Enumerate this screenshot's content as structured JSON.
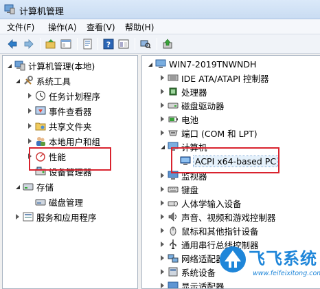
{
  "window": {
    "title": "计算机管理"
  },
  "menu": [
    "文件(F)",
    "操作(A)",
    "查看(V)",
    "帮助(H)"
  ],
  "toolbar": [
    "back-icon",
    "forward-icon",
    "up-folder-icon",
    "show-tree-icon",
    "properties-icon",
    "help-icon",
    "console-view-icon",
    "scan-icon",
    "update-driver-icon"
  ],
  "left_tree": [
    {
      "label": "计算机管理(本地)",
      "icon": "computer-mgmt-icon",
      "arrow": "open"
    },
    {
      "label": "系统工具",
      "icon": "tools-icon",
      "arrow": "open"
    },
    {
      "label": "任务计划程序",
      "icon": "clock-icon",
      "arrow": "closed"
    },
    {
      "label": "事件查看器",
      "icon": "event-viewer-icon",
      "arrow": "closed"
    },
    {
      "label": "共享文件夹",
      "icon": "shared-folder-icon",
      "arrow": "closed"
    },
    {
      "label": "本地用户和组",
      "icon": "users-icon",
      "arrow": "closed"
    },
    {
      "label": "性能",
      "icon": "performance-icon",
      "arrow": "closed"
    },
    {
      "label": "设备管理器",
      "icon": "device-manager-icon",
      "arrow": "none"
    },
    {
      "label": "存储",
      "icon": "storage-icon",
      "arrow": "open"
    },
    {
      "label": "磁盘管理",
      "icon": "disk-mgmt-icon",
      "arrow": "none"
    },
    {
      "label": "服务和应用程序",
      "icon": "services-icon",
      "arrow": "closed"
    }
  ],
  "right_tree": {
    "root": "WIN7-2019TNWNDH",
    "items": [
      {
        "label": "IDE ATA/ATAPI 控制器",
        "icon": "ide-icon",
        "arrow": "closed"
      },
      {
        "label": "处理器",
        "icon": "cpu-icon",
        "arrow": "closed"
      },
      {
        "label": "磁盘驱动器",
        "icon": "disk-drive-icon",
        "arrow": "closed"
      },
      {
        "label": "电池",
        "icon": "battery-icon",
        "arrow": "closed"
      },
      {
        "label": "端口 (COM 和 LPT)",
        "icon": "port-icon",
        "arrow": "closed"
      },
      {
        "label": "计算机",
        "icon": "computer-icon",
        "arrow": "open"
      },
      {
        "label": "ACPI x64-based PC",
        "icon": "pc-icon",
        "arrow": "none"
      },
      {
        "label": "监视器",
        "icon": "monitor-icon",
        "arrow": "closed"
      },
      {
        "label": "键盘",
        "icon": "keyboard-icon",
        "arrow": "closed"
      },
      {
        "label": "人体学输入设备",
        "icon": "hid-icon",
        "arrow": "closed"
      },
      {
        "label": "声音、视频和游戏控制器",
        "icon": "sound-icon",
        "arrow": "closed"
      },
      {
        "label": "鼠标和其他指针设备",
        "icon": "mouse-icon",
        "arrow": "closed"
      },
      {
        "label": "通用串行总线控制器",
        "icon": "usb-icon",
        "arrow": "closed"
      },
      {
        "label": "网络适配器",
        "icon": "network-icon",
        "arrow": "closed"
      },
      {
        "label": "系统设备",
        "icon": "system-devices-icon",
        "arrow": "closed"
      },
      {
        "label": "显示适配器",
        "icon": "display-adapter-icon",
        "arrow": "closed"
      }
    ]
  },
  "watermark": {
    "text": "飞飞系统",
    "url": "www.feifeixitong.com"
  },
  "colors": {
    "highlight_box": "#d9232e",
    "accent": "#1f86d9"
  }
}
